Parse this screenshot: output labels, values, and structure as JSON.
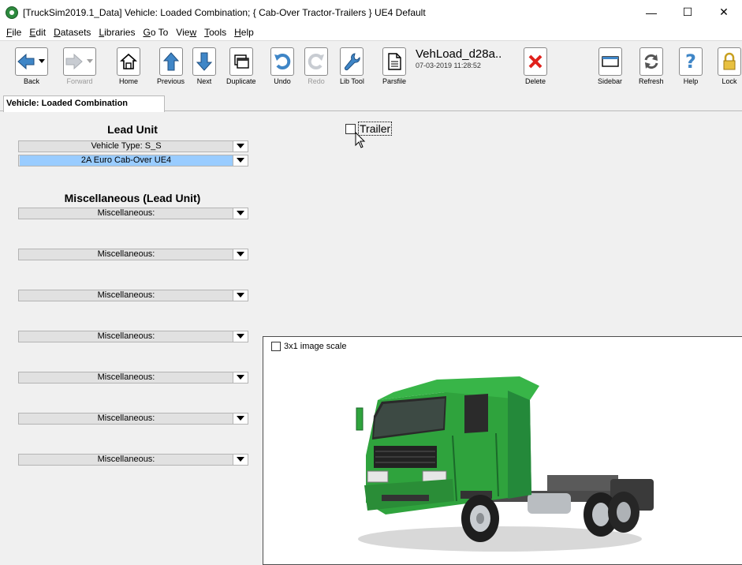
{
  "window": {
    "title": "[TruckSim2019.1_Data] Vehicle: Loaded Combination; { Cab-Over Tractor-Trailers } UE4 Default",
    "controls": {
      "minimize": "—",
      "maximize": "☐",
      "close": "✕"
    }
  },
  "menu": {
    "items": [
      {
        "key": "F",
        "rest": "ile"
      },
      {
        "key": "E",
        "rest": "dit"
      },
      {
        "key": "D",
        "rest": "atasets"
      },
      {
        "key": "L",
        "rest": "ibraries"
      },
      {
        "key": "G",
        "rest": "o To"
      },
      {
        "pre": "Vie",
        "key": "w",
        "rest": ""
      },
      {
        "key": "T",
        "rest": "ools"
      },
      {
        "key": "H",
        "rest": "elp"
      }
    ]
  },
  "toolbar": {
    "back": "Back",
    "forward": "Forward",
    "home": "Home",
    "previous": "Previous",
    "next": "Next",
    "duplicate": "Duplicate",
    "undo": "Undo",
    "redo": "Redo",
    "lib_tool": "Lib Tool",
    "parsfile": "Parsfile",
    "file_name": "VehLoad_d28a..",
    "file_date": "07-03-2019 11:28:52",
    "delete": "Delete",
    "sidebar": "Sidebar",
    "refresh": "Refresh",
    "help": "Help",
    "lock": "Lock"
  },
  "tab": {
    "label": "Vehicle: Loaded Combination"
  },
  "lead_unit": {
    "title": "Lead Unit",
    "vehicle_type": "Vehicle Type: S_S",
    "vehicle": "2A Euro Cab-Over UE4"
  },
  "misc": {
    "title": "Miscellaneous (Lead Unit)",
    "items": [
      "Miscellaneous:",
      "Miscellaneous:",
      "Miscellaneous:",
      "Miscellaneous:",
      "Miscellaneous:",
      "Miscellaneous:",
      "Miscellaneous:"
    ]
  },
  "trailer": {
    "label": "Trailer",
    "checked": false
  },
  "image_panel": {
    "scale_label": "3x1 image scale",
    "checked": false
  },
  "colors": {
    "selection": "#99ccff",
    "truck_green": "#2fa33d",
    "accent_blue": "#3f86c7",
    "delete_red": "#e0201b"
  }
}
